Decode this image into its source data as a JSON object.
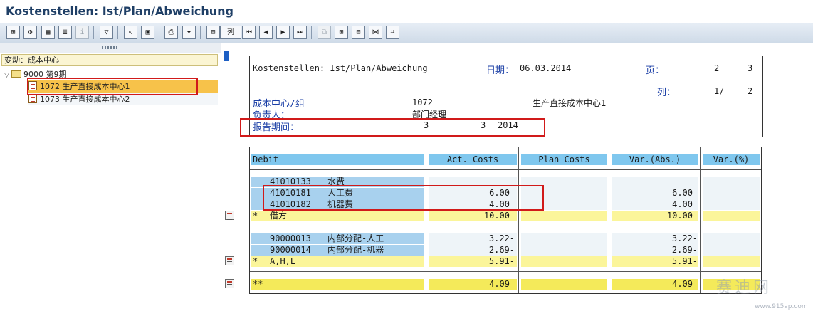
{
  "window": {
    "title": "Kostenstellen: Ist/Plan/Abweichung"
  },
  "toolbar": {
    "col_button_label": "列"
  },
  "tree": {
    "header": "变动：成本中心",
    "group": {
      "code": "9000",
      "label": "第9期"
    },
    "items": [
      {
        "label": "1072 生产直接成本中心1",
        "selected": true
      },
      {
        "label": "1073 生产直接成本中心2",
        "selected": false
      }
    ]
  },
  "report": {
    "title": "Kostenstellen: Ist/Plan/Abweichung",
    "date_label": "日期：",
    "date_value": "06.03.2014",
    "page_label": "页：",
    "page_current": "2",
    "page_total": "3",
    "col_label": "列：",
    "col_current": "1/",
    "col_total": "2",
    "cost_center_label": "成本中心/组",
    "cost_center_code": "1072",
    "cost_center_name": "生产直接成本中心1",
    "responsible_label": "负责人：",
    "responsible_value": "部门经理",
    "period_label": "报告期间：",
    "period_from": "3",
    "period_to": "3",
    "period_year": "2014"
  },
  "table": {
    "headers": [
      "Debit",
      "Act. Costs",
      "Plan Costs",
      "Var.(Abs.)",
      "Var.(%)"
    ],
    "group1": [
      {
        "account": "41010133",
        "name": "水费",
        "act": "",
        "plan": "",
        "var_abs": "",
        "var_pct": ""
      },
      {
        "account": "41010181",
        "name": "人工费",
        "act": "6.00",
        "plan": "",
        "var_abs": "6.00",
        "var_pct": ""
      },
      {
        "account": "41010182",
        "name": "机器费",
        "act": "4.00",
        "plan": "",
        "var_abs": "4.00",
        "var_pct": ""
      }
    ],
    "subtotal1": {
      "marker": "*",
      "label": "借方",
      "act": "10.00",
      "var_abs": "10.00"
    },
    "group2": [
      {
        "account": "90000013",
        "name": "内部分配-人工",
        "act": "3.22-",
        "plan": "",
        "var_abs": "3.22-",
        "var_pct": ""
      },
      {
        "account": "90000014",
        "name": "内部分配-机器",
        "act": "2.69-",
        "plan": "",
        "var_abs": "2.69-",
        "var_pct": ""
      }
    ],
    "subtotal2": {
      "marker": "*",
      "label": "A,H,L",
      "act": "5.91-",
      "var_abs": "5.91-"
    },
    "total": {
      "marker": "**",
      "act": "4.09",
      "var_abs": "4.09"
    }
  },
  "watermark": {
    "text": "赛迪网",
    "url": "www.915ap.com"
  }
}
